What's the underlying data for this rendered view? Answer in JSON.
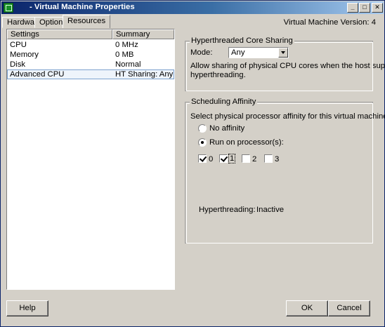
{
  "window": {
    "title": "- Virtual Machine Properties",
    "controls": {
      "minimize": "_",
      "maximize": "□",
      "close": "✕"
    }
  },
  "tabs": [
    {
      "label": "Hardware",
      "active": false
    },
    {
      "label": "Options",
      "active": false
    },
    {
      "label": "Resources",
      "active": true
    }
  ],
  "vm_version": "Virtual Machine Version: 4",
  "settings_grid": {
    "headers": {
      "settings": "Settings",
      "summary": "Summary"
    },
    "rows": [
      {
        "setting": "CPU",
        "summary": "0 MHz"
      },
      {
        "setting": "Memory",
        "summary": "0 MB"
      },
      {
        "setting": "Disk",
        "summary": "Normal"
      },
      {
        "setting": "Advanced CPU",
        "summary": "HT Sharing: Any",
        "selected": true
      }
    ]
  },
  "ht_sharing": {
    "title": "Hyperthreaded Core Sharing",
    "mode_label": "Mode:",
    "mode_value": "Any",
    "desc_line1": "Allow sharing of physical CPU cores when the host supports",
    "desc_line2": "hyperthreading."
  },
  "affinity": {
    "title": "Scheduling Affinity",
    "prompt": "Select physical processor affinity for this virtual machine:",
    "no_affinity_label": "No affinity",
    "run_on_label": "Run on processor(s):",
    "selected_option": "run_on",
    "processors": [
      {
        "label": "0",
        "checked": true
      },
      {
        "label": "1",
        "checked": true
      },
      {
        "label": "2",
        "checked": false
      },
      {
        "label": "3",
        "checked": false
      }
    ],
    "hyperthreading_label": "Hyperthreading:",
    "hyperthreading_value": "Inactive"
  },
  "buttons": {
    "help": "Help",
    "ok": "OK",
    "cancel": "Cancel"
  }
}
